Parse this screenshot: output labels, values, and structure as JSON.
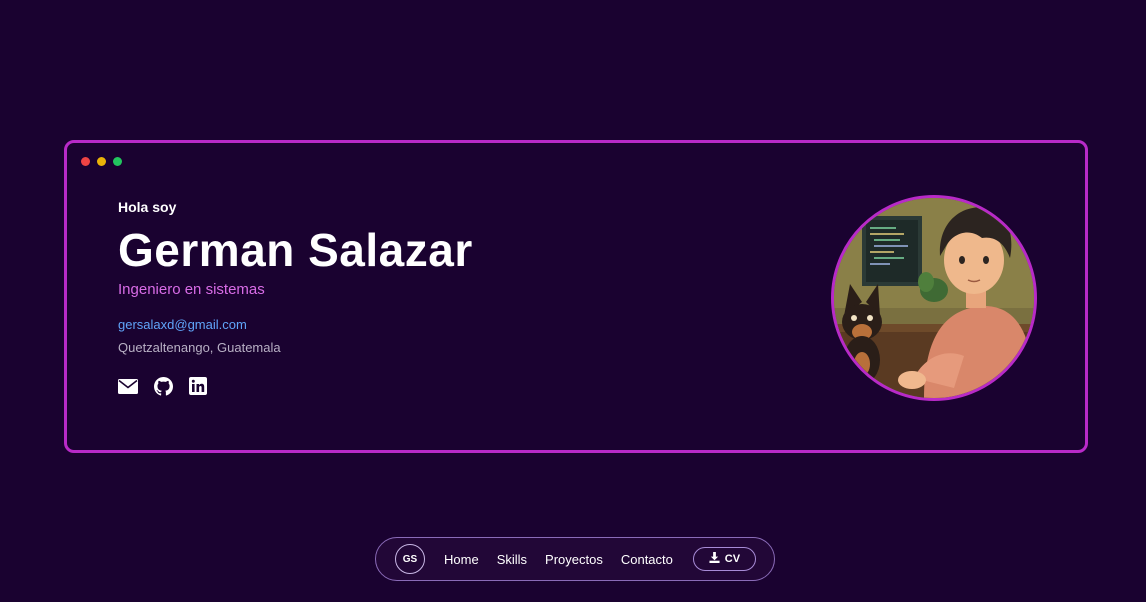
{
  "hero": {
    "greeting": "Hola soy",
    "name": "German Salazar",
    "role": "Ingeniero en sistemas",
    "email": "gersalaxd@gmail.com",
    "location": "Quetzaltenango, Guatemala",
    "socials": [
      {
        "icon": "envelope-icon"
      },
      {
        "icon": "github-icon"
      },
      {
        "icon": "linkedin-icon"
      }
    ]
  },
  "window_dots": [
    "red",
    "yellow",
    "green"
  ],
  "nav": {
    "logo": "GS",
    "links": [
      "Home",
      "Skills",
      "Proyectos",
      "Contacto"
    ],
    "cv_label": "CV",
    "cv_icon": "download-icon"
  },
  "colors": {
    "background": "#1a0230",
    "accent": "#b82ac8",
    "role_text": "#d86ce6",
    "email_link": "#60a5fa"
  }
}
